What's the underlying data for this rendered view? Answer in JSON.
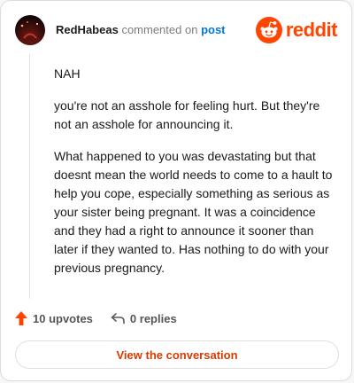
{
  "header": {
    "author": "RedHabeas",
    "action": "commented on",
    "post_link": "post",
    "brand": "reddit"
  },
  "comment": {
    "paragraphs": [
      "NAH",
      "you're not an asshole for feeling hurt. But they're not an asshole for announcing it.",
      "What happened to you was devastating but that doesnt mean the world needs to come to a hault to help you cope, especially something as serious as your sister being pregnant. It was a coincidence and they had a right to announce it sooner than later if they wanted to. Has nothing to do with your previous pregnancy."
    ]
  },
  "stats": {
    "upvotes": "10 upvotes",
    "replies": "0 replies"
  },
  "footer": {
    "view_label": "View the conversation"
  },
  "icons": {
    "upvote": "upvote-arrow-icon",
    "reply": "reply-icon",
    "brand": "reddit-snoo-icon"
  },
  "colors": {
    "accent": "#ff4500",
    "link": "#0079d3",
    "button_text": "#d93a00"
  }
}
